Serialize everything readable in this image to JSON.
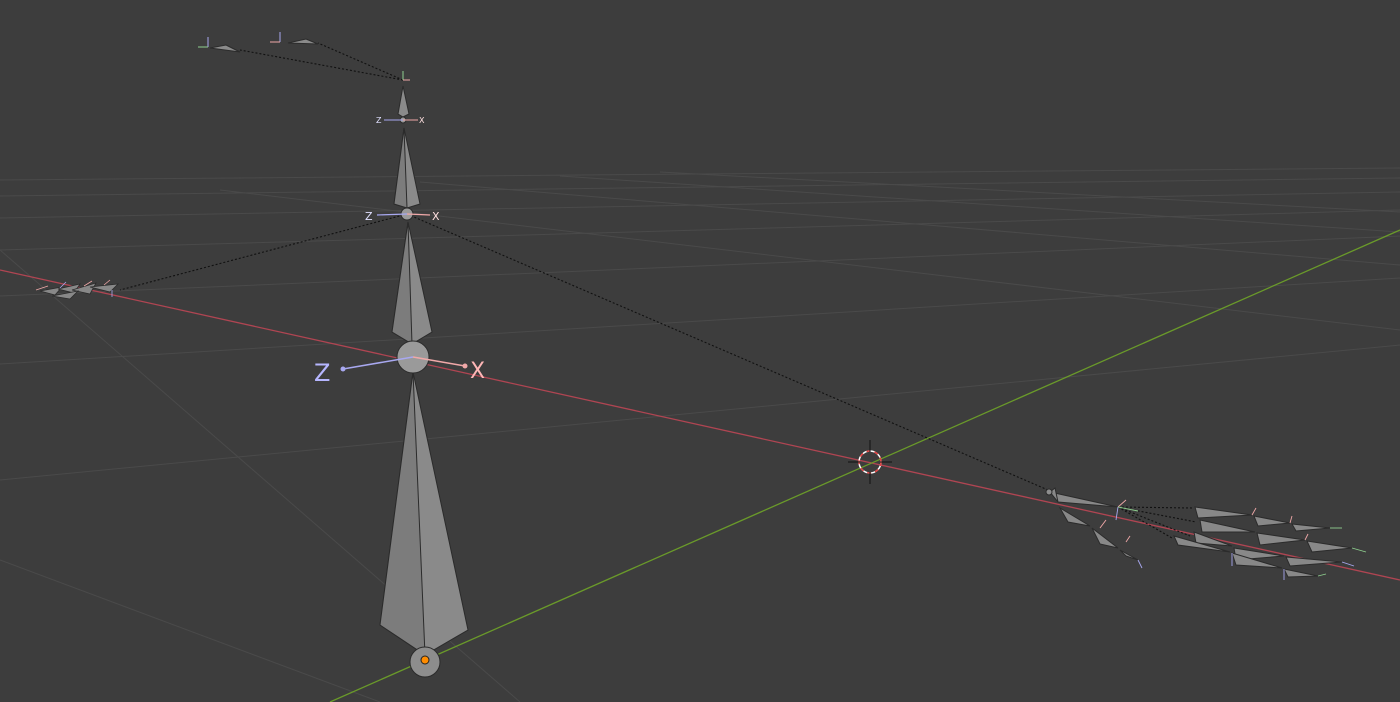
{
  "viewport": {
    "background": "#3d3d3d",
    "grid_color": "#4a4a4a",
    "x_axis_color": "#b04552",
    "y_axis_color": "#6a9a2a",
    "bone_fill": "#8a8a8a",
    "bone_edge": "#2b2b2b",
    "relationship_line_color": "#111111",
    "selected_joint_color": "#ff8c00"
  },
  "gizmo": {
    "large": {
      "z_label": "Z",
      "x_label": "X",
      "z_color": "#a8a8f0",
      "x_color": "#f0a8a8"
    },
    "medium": {
      "z_label": "Z",
      "x_label": "X"
    },
    "small": {
      "z_label": "Z",
      "x_label": "X"
    }
  },
  "cursor_3d": {
    "name": "3d-cursor",
    "color_a": "#e04040",
    "color_b": "#ffffff"
  },
  "icons": [
    "3d-cursor-icon",
    "bone-icon",
    "axis-gizmo-icon"
  ]
}
